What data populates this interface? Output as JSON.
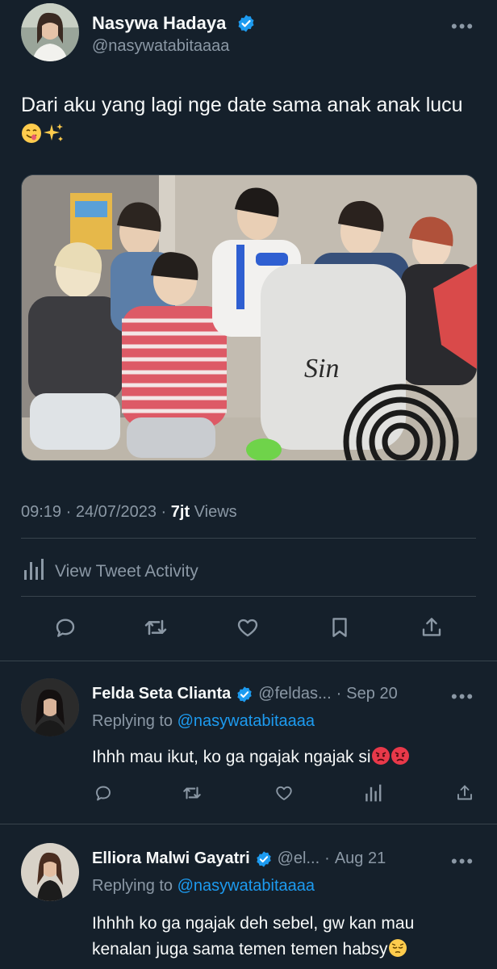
{
  "colors": {
    "background": "#15202b",
    "text": "#f7f9f9",
    "muted": "#8b98a5",
    "link": "#1d9bf0",
    "divider": "#38444d",
    "verified": "#1d9bf0"
  },
  "main_tweet": {
    "author_name": "Nasywa Hadaya",
    "handle": "@nasywatabitaaaa",
    "text": "Dari aku yang lagi nge date sama anak anak lucu",
    "text_emojis": [
      "face-savoring-food",
      "sparkles"
    ],
    "time": "09:19",
    "date": "24/07/2023",
    "views_count": "7jt",
    "views_label": "Views",
    "activity_label": "View Tweet Activity",
    "actions": [
      "reply-icon",
      "retweet-icon",
      "like-icon",
      "bookmark-icon",
      "share-icon"
    ]
  },
  "replies": [
    {
      "author_name": "Felda Seta Clianta",
      "handle": "@feldas...",
      "date": "Sep 20",
      "replying_prefix": "Replying to",
      "replying_handle": "@nasywatabitaaaa",
      "text": "Ihhh mau ikut, ko ga ngajak ngajak si",
      "text_emojis": [
        "enraged-face",
        "enraged-face"
      ],
      "actions": [
        "reply-icon",
        "retweet-icon",
        "like-icon",
        "views-icon",
        "share-icon"
      ]
    },
    {
      "author_name": "Elliora Malwi Gayatri",
      "handle": "@el...",
      "date": "Aug 21",
      "replying_prefix": "Replying to",
      "replying_handle": "@nasywatabitaaaa",
      "text_line1": "Ihhhh ko ga ngajak deh sebel, gw kan mau",
      "text_line2": "kenalan juga sama temen temen habsy",
      "text_emojis": [
        "pensive-face"
      ]
    }
  ],
  "separator": "·"
}
